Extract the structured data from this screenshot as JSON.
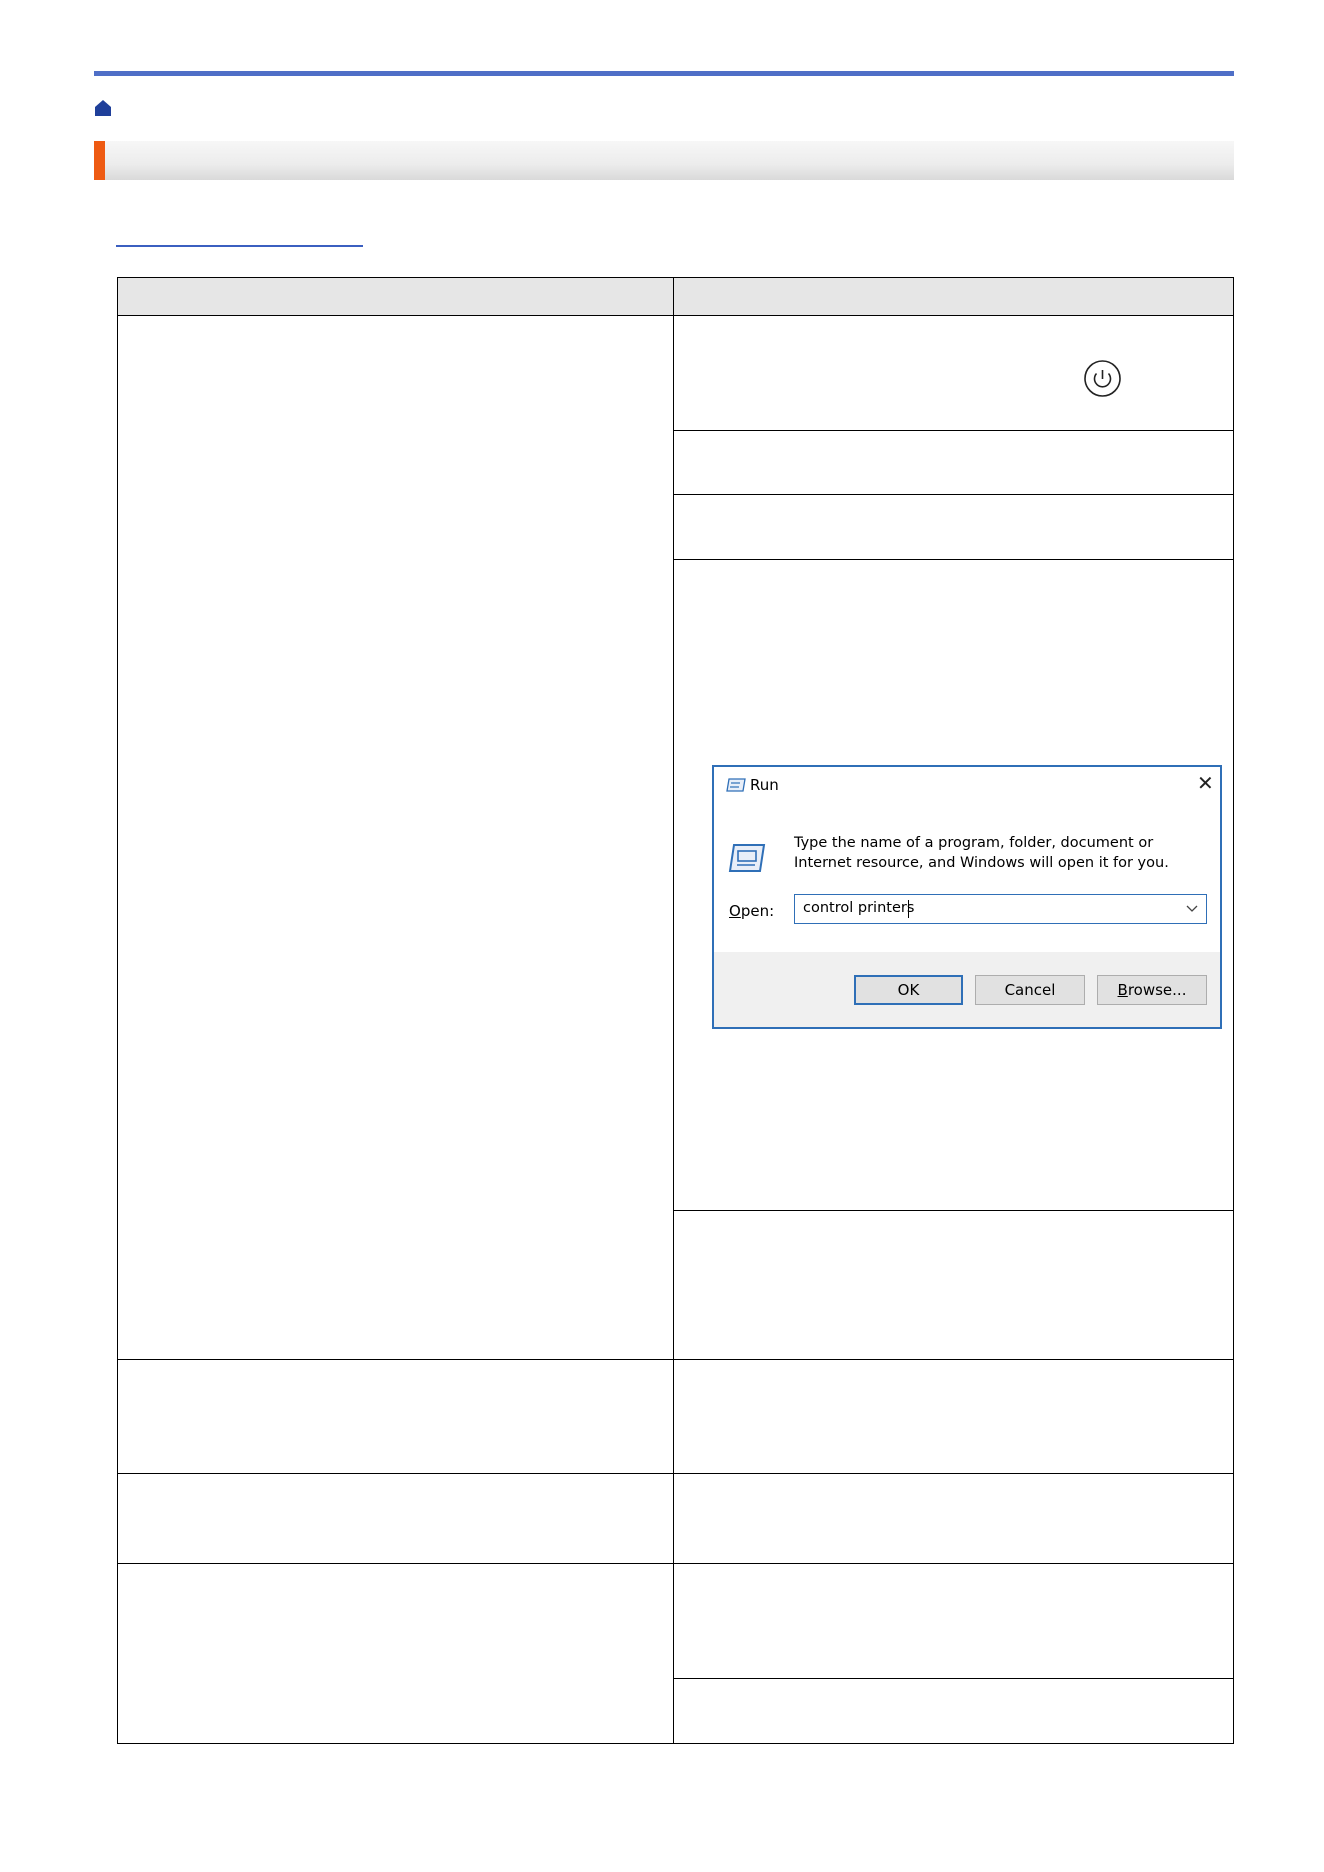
{
  "colors": {
    "top_rule": "#4f6fc7",
    "section_accent": "#ee5a12",
    "link": "#3b5fc0",
    "dialog_border": "#2f6fb7"
  },
  "icons": {
    "home": "home-icon",
    "power": "power-icon",
    "run": "run-icon",
    "close": "close-icon",
    "dropdown": "chevron-down-icon"
  },
  "run_dialog": {
    "title": "Run",
    "description": "Type the name of a program, folder, document or Internet resource, and Windows will open it for you.",
    "open_label_mnemonic": "O",
    "open_label_rest": "pen:",
    "input_value": "control printers",
    "ok_label": "OK",
    "cancel_label": "Cancel",
    "browse_label_mnemonic": "B",
    "browse_label_rest": "rowse..."
  }
}
